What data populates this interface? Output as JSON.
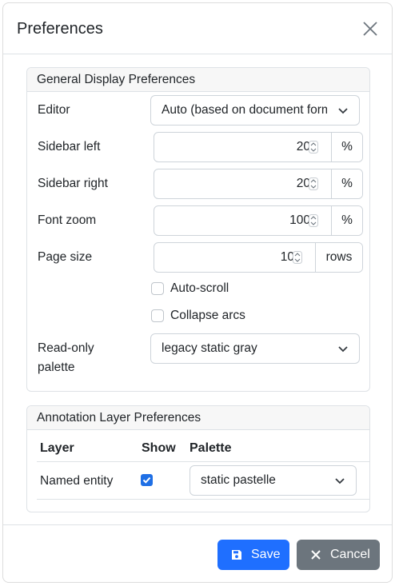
{
  "dialog": {
    "title": "Preferences"
  },
  "general": {
    "legend": "General Display Preferences",
    "editor": {
      "label": "Editor",
      "value": "Auto (based on document format)"
    },
    "sidebar_left": {
      "label": "Sidebar left",
      "value": "20",
      "unit": "%"
    },
    "sidebar_right": {
      "label": "Sidebar right",
      "value": "20",
      "unit": "%"
    },
    "font_zoom": {
      "label": "Font zoom",
      "value": "100",
      "unit": "%"
    },
    "page_size": {
      "label": "Page size",
      "value": "10",
      "unit": "rows"
    },
    "auto_scroll": {
      "label": "Auto-scroll",
      "checked": false
    },
    "collapse_arcs": {
      "label": "Collapse arcs",
      "checked": false
    },
    "readonly_palette": {
      "label_line1": "Read-only",
      "label_line2": "palette",
      "value": "legacy static gray"
    }
  },
  "annotation": {
    "legend": "Annotation Layer Preferences",
    "columns": {
      "layer": "Layer",
      "show": "Show",
      "palette": "Palette"
    },
    "rows": [
      {
        "layer": "Named entity",
        "show": true,
        "palette": "static pastelle"
      }
    ]
  },
  "footer": {
    "save_label": "Save",
    "cancel_label": "Cancel"
  },
  "colors": {
    "primary": "#1f6fff",
    "secondary": "#6c757d",
    "checkbox": "#1f6fe5"
  },
  "icons": {
    "close": "close-icon",
    "save": "floppy-disk-icon",
    "cancel": "x-icon",
    "dropdown": "chevron-down-icon"
  }
}
